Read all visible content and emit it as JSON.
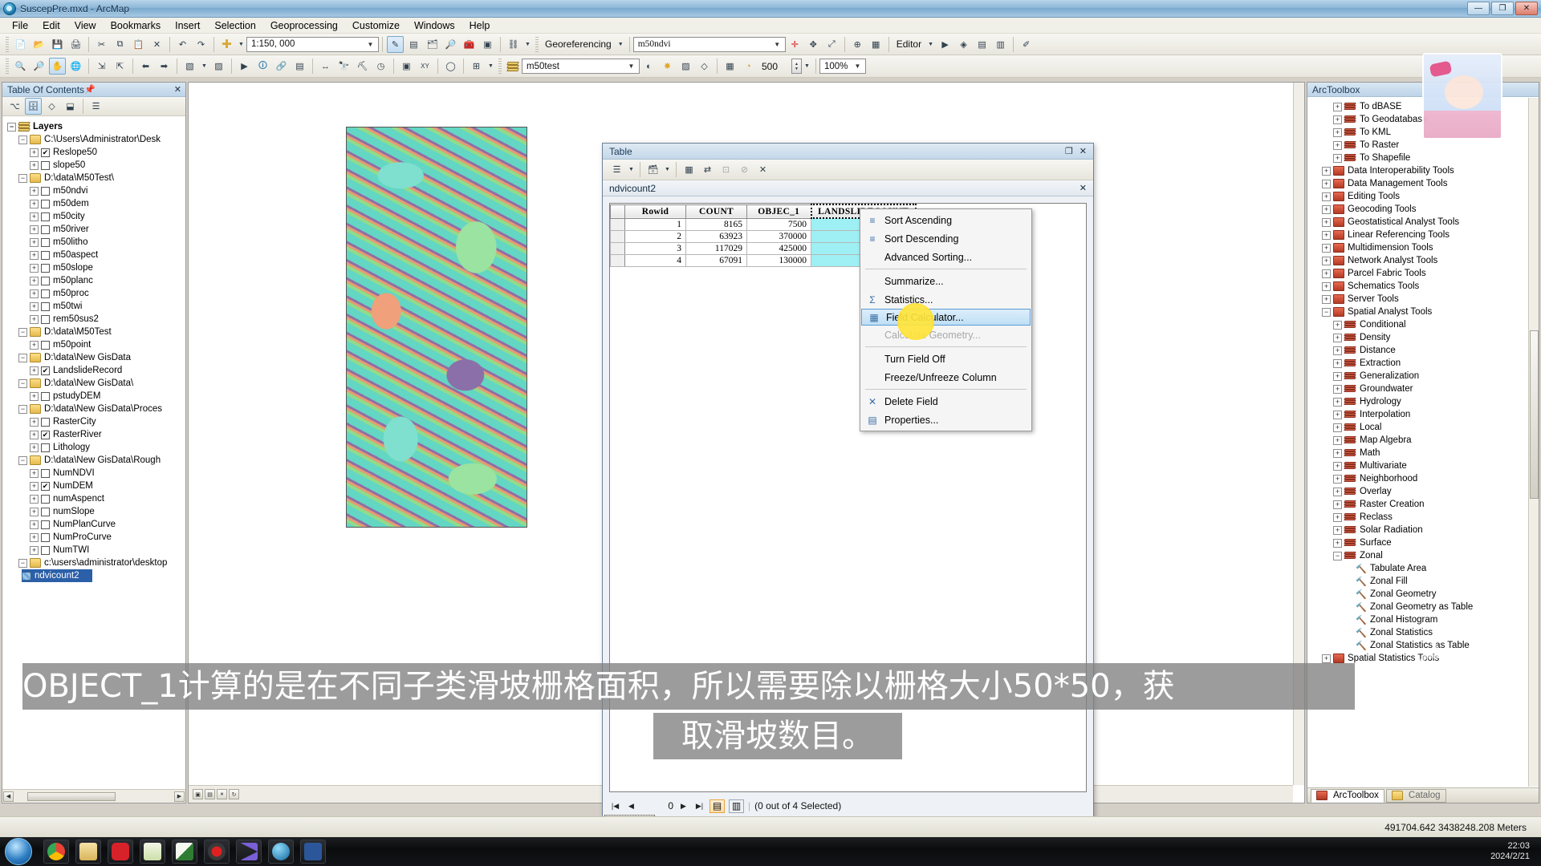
{
  "window": {
    "title": "SuscepPre.mxd - ArcMap",
    "icon": "arcmap-globe-icon",
    "minimize": "—",
    "restore": "❐",
    "close": "✕"
  },
  "menubar": [
    "File",
    "Edit",
    "View",
    "Bookmarks",
    "Insert",
    "Selection",
    "Geoprocessing",
    "Customize",
    "Windows",
    "Help"
  ],
  "toolbar": {
    "scale_value": "1:150, 000",
    "georeferencing_label": "Georeferencing",
    "georef_layer": "m50ndvi",
    "sa_layer": "m50test",
    "cellsize_value": "500",
    "editor_label": "Editor",
    "zoom_percent": "100%",
    "search_value": ""
  },
  "toc": {
    "header": "Table Of Contents",
    "pin_icon": "pin-icon",
    "close_icon": "close-icon",
    "root": "Layers",
    "items": [
      {
        "type": "folder",
        "label": "C:\\Users\\Administrator\\Desk",
        "indent": 1
      },
      {
        "type": "layer",
        "label": "Reslope50",
        "checked": true,
        "indent": 2
      },
      {
        "type": "layer",
        "label": "slope50",
        "checked": false,
        "indent": 2
      },
      {
        "type": "folder",
        "label": "D:\\data\\M50Test\\",
        "indent": 1
      },
      {
        "type": "layer",
        "label": "m50ndvi",
        "checked": false,
        "indent": 2
      },
      {
        "type": "layer",
        "label": "m50dem",
        "checked": false,
        "indent": 2
      },
      {
        "type": "layer",
        "label": "m50city",
        "checked": false,
        "indent": 2
      },
      {
        "type": "layer",
        "label": "m50river",
        "checked": false,
        "indent": 2
      },
      {
        "type": "layer",
        "label": "m50litho",
        "checked": false,
        "indent": 2
      },
      {
        "type": "layer",
        "label": "m50aspect",
        "checked": false,
        "indent": 2
      },
      {
        "type": "layer",
        "label": "m50slope",
        "checked": false,
        "indent": 2
      },
      {
        "type": "layer",
        "label": "m50planc",
        "checked": false,
        "indent": 2
      },
      {
        "type": "layer",
        "label": "m50proc",
        "checked": false,
        "indent": 2
      },
      {
        "type": "layer",
        "label": "m50twi",
        "checked": false,
        "indent": 2
      },
      {
        "type": "layer",
        "label": "rem50sus2",
        "checked": false,
        "indent": 2
      },
      {
        "type": "folder",
        "label": "D:\\data\\M50Test",
        "indent": 1
      },
      {
        "type": "layer",
        "label": "m50point",
        "checked": false,
        "indent": 2
      },
      {
        "type": "folder",
        "label": "D:\\data\\New GisData",
        "indent": 1
      },
      {
        "type": "layer",
        "label": "LandslideRecord",
        "checked": true,
        "indent": 2
      },
      {
        "type": "folder",
        "label": "D:\\data\\New GisData\\",
        "indent": 1
      },
      {
        "type": "layer",
        "label": "pstudyDEM",
        "checked": false,
        "indent": 2
      },
      {
        "type": "folder",
        "label": "D:\\data\\New GisData\\Proces",
        "indent": 1
      },
      {
        "type": "layer",
        "label": "RasterCity",
        "checked": false,
        "indent": 2
      },
      {
        "type": "layer",
        "label": "RasterRiver",
        "checked": true,
        "indent": 2
      },
      {
        "type": "layer",
        "label": "Lithology",
        "checked": false,
        "indent": 2
      },
      {
        "type": "folder",
        "label": "D:\\data\\New GisData\\Rough",
        "indent": 1
      },
      {
        "type": "layer",
        "label": "NumNDVI",
        "checked": false,
        "indent": 2
      },
      {
        "type": "layer",
        "label": "NumDEM",
        "checked": true,
        "indent": 2
      },
      {
        "type": "layer",
        "label": "numAspenct",
        "checked": false,
        "indent": 2
      },
      {
        "type": "layer",
        "label": "numSlope",
        "checked": false,
        "indent": 2
      },
      {
        "type": "layer",
        "label": "NumPlanCurve",
        "checked": false,
        "indent": 2
      },
      {
        "type": "layer",
        "label": "NumProCurve",
        "checked": false,
        "indent": 2
      },
      {
        "type": "layer",
        "label": "NumTWI",
        "checked": false,
        "indent": 2
      },
      {
        "type": "folder",
        "label": "c:\\users\\administrator\\desktop",
        "indent": 1
      },
      {
        "type": "selected",
        "label": "ndvicount2",
        "indent": 2
      }
    ]
  },
  "table_window": {
    "title": "Table",
    "restore_icon": "restore-icon",
    "close_icon": "close-icon",
    "tab_label": "ndvicount2",
    "tab_close_icon": "close-icon",
    "columns": [
      "Rowid",
      "COUNT",
      "OBJEC_1",
      "LANDSLIDECOUNT"
    ],
    "selected_column": "LANDSLIDECOUNT",
    "rows": [
      {
        "Rowid": "1",
        "COUNT": "8165",
        "OBJEC_1": "7500",
        "LANDSLIDECOUNT": ""
      },
      {
        "Rowid": "2",
        "COUNT": "63923",
        "OBJEC_1": "370000",
        "LANDSLIDECOUNT": ""
      },
      {
        "Rowid": "3",
        "COUNT": "117029",
        "OBJEC_1": "425000",
        "LANDSLIDECOUNT": ""
      },
      {
        "Rowid": "4",
        "COUNT": "67091",
        "OBJEC_1": "130000",
        "LANDSLIDECOUNT": ""
      }
    ],
    "nav": {
      "first_icon": "first-record-icon",
      "prev_icon": "previous-record-icon",
      "record_number": "0",
      "next_icon": "next-record-icon",
      "last_icon": "last-record-icon",
      "table_view_icon": "table-view-icon",
      "form_view_icon": "form-view-icon",
      "selection_status": "(0 out of 4 Selected)"
    },
    "status_label": "ndvicount2"
  },
  "context_menu": {
    "highlighted": "Field Calculator...",
    "items": [
      {
        "label": "Sort Ascending",
        "icon": "sort-ascending-icon",
        "enabled": true,
        "sep_after": false
      },
      {
        "label": "Sort Descending",
        "icon": "sort-descending-icon",
        "enabled": true,
        "sep_after": false
      },
      {
        "label": "Advanced Sorting...",
        "icon": "",
        "enabled": true,
        "sep_after": true
      },
      {
        "label": "Summarize...",
        "icon": "",
        "enabled": true,
        "sep_after": false
      },
      {
        "label": "Statistics...",
        "icon": "sigma-icon",
        "enabled": true,
        "sep_after": false
      },
      {
        "label": "Field Calculator...",
        "icon": "calculator-icon",
        "enabled": true,
        "sep_after": false
      },
      {
        "label": "Calculate Geometry...",
        "icon": "",
        "enabled": false,
        "sep_after": true
      },
      {
        "label": "Turn Field Off",
        "icon": "",
        "enabled": true,
        "sep_after": false
      },
      {
        "label": "Freeze/Unfreeze Column",
        "icon": "",
        "enabled": true,
        "sep_after": true
      },
      {
        "label": "Delete Field",
        "icon": "delete-x-icon",
        "enabled": true,
        "sep_after": false
      },
      {
        "label": "Properties...",
        "icon": "properties-icon",
        "enabled": true,
        "sep_after": false
      }
    ]
  },
  "arctoolbox": {
    "header": "ArcToolbox",
    "items": [
      {
        "label": "To dBASE",
        "kind": "toolset",
        "indent": 2,
        "expand": "+"
      },
      {
        "label": "To Geodatabase",
        "kind": "toolset",
        "indent": 2,
        "expand": "+"
      },
      {
        "label": "To KML",
        "kind": "toolset",
        "indent": 2,
        "expand": "+"
      },
      {
        "label": "To Raster",
        "kind": "toolset",
        "indent": 2,
        "expand": "+"
      },
      {
        "label": "To Shapefile",
        "kind": "toolset",
        "indent": 2,
        "expand": "+"
      },
      {
        "label": "Data Interoperability Tools",
        "kind": "toolbox",
        "indent": 1,
        "expand": "+"
      },
      {
        "label": "Data Management Tools",
        "kind": "toolbox",
        "indent": 1,
        "expand": "+"
      },
      {
        "label": "Editing Tools",
        "kind": "toolbox",
        "indent": 1,
        "expand": "+"
      },
      {
        "label": "Geocoding Tools",
        "kind": "toolbox",
        "indent": 1,
        "expand": "+"
      },
      {
        "label": "Geostatistical Analyst Tools",
        "kind": "toolbox",
        "indent": 1,
        "expand": "+"
      },
      {
        "label": "Linear Referencing Tools",
        "kind": "toolbox",
        "indent": 1,
        "expand": "+"
      },
      {
        "label": "Multidimension Tools",
        "kind": "toolbox",
        "indent": 1,
        "expand": "+"
      },
      {
        "label": "Network Analyst Tools",
        "kind": "toolbox",
        "indent": 1,
        "expand": "+"
      },
      {
        "label": "Parcel Fabric Tools",
        "kind": "toolbox",
        "indent": 1,
        "expand": "+"
      },
      {
        "label": "Schematics Tools",
        "kind": "toolbox",
        "indent": 1,
        "expand": "+"
      },
      {
        "label": "Server Tools",
        "kind": "toolbox",
        "indent": 1,
        "expand": "+"
      },
      {
        "label": "Spatial Analyst Tools",
        "kind": "toolbox",
        "indent": 1,
        "expand": "-"
      },
      {
        "label": "Conditional",
        "kind": "toolset",
        "indent": 2,
        "expand": "+"
      },
      {
        "label": "Density",
        "kind": "toolset",
        "indent": 2,
        "expand": "+"
      },
      {
        "label": "Distance",
        "kind": "toolset",
        "indent": 2,
        "expand": "+"
      },
      {
        "label": "Extraction",
        "kind": "toolset",
        "indent": 2,
        "expand": "+"
      },
      {
        "label": "Generalization",
        "kind": "toolset",
        "indent": 2,
        "expand": "+"
      },
      {
        "label": "Groundwater",
        "kind": "toolset",
        "indent": 2,
        "expand": "+"
      },
      {
        "label": "Hydrology",
        "kind": "toolset",
        "indent": 2,
        "expand": "+"
      },
      {
        "label": "Interpolation",
        "kind": "toolset",
        "indent": 2,
        "expand": "+"
      },
      {
        "label": "Local",
        "kind": "toolset",
        "indent": 2,
        "expand": "+"
      },
      {
        "label": "Map Algebra",
        "kind": "toolset",
        "indent": 2,
        "expand": "+"
      },
      {
        "label": "Math",
        "kind": "toolset",
        "indent": 2,
        "expand": "+"
      },
      {
        "label": "Multivariate",
        "kind": "toolset",
        "indent": 2,
        "expand": "+"
      },
      {
        "label": "Neighborhood",
        "kind": "toolset",
        "indent": 2,
        "expand": "+"
      },
      {
        "label": "Overlay",
        "kind": "toolset",
        "indent": 2,
        "expand": "+"
      },
      {
        "label": "Raster Creation",
        "kind": "toolset",
        "indent": 2,
        "expand": "+"
      },
      {
        "label": "Reclass",
        "kind": "toolset",
        "indent": 2,
        "expand": "+"
      },
      {
        "label": "Solar Radiation",
        "kind": "toolset",
        "indent": 2,
        "expand": "+"
      },
      {
        "label": "Surface",
        "kind": "toolset",
        "indent": 2,
        "expand": "+"
      },
      {
        "label": "Zonal",
        "kind": "toolset",
        "indent": 2,
        "expand": "-"
      },
      {
        "label": "Tabulate Area",
        "kind": "tool",
        "indent": 3,
        "expand": ""
      },
      {
        "label": "Zonal Fill",
        "kind": "tool",
        "indent": 3,
        "expand": ""
      },
      {
        "label": "Zonal Geometry",
        "kind": "tool",
        "indent": 3,
        "expand": ""
      },
      {
        "label": "Zonal Geometry as Table",
        "kind": "tool",
        "indent": 3,
        "expand": ""
      },
      {
        "label": "Zonal Histogram",
        "kind": "tool",
        "indent": 3,
        "expand": ""
      },
      {
        "label": "Zonal Statistics",
        "kind": "tool",
        "indent": 3,
        "expand": ""
      },
      {
        "label": "Zonal Statistics as Table",
        "kind": "tool",
        "indent": 3,
        "expand": ""
      },
      {
        "label": "Spatial Statistics Tools",
        "kind": "toolbox",
        "indent": 1,
        "expand": "+"
      }
    ],
    "tabs": [
      {
        "label": "ArcToolbox",
        "active": true
      },
      {
        "label": "Catalog",
        "active": false
      }
    ]
  },
  "statusbar": {
    "coordinates": "491704.642  3438248.208 Meters"
  },
  "subtitles": {
    "line1": "OBJECT_1计算的是在不同子类滑坡栅格面积，所以需要除以栅格大小50*50，获",
    "line2": "取滑坡数目。"
  },
  "taskbar": {
    "start_icon": "windows-start-icon",
    "items": [
      {
        "name": "chrome-icon",
        "color": "#d94b3a"
      },
      {
        "name": "file-explorer-icon",
        "color": "#e8c46a"
      },
      {
        "name": "netease-music-icon",
        "color": "#d8222a"
      },
      {
        "name": "notepad-plus-icon",
        "color": "#e9f0d6"
      },
      {
        "name": "excel-icon",
        "color": "#cfe3c2"
      },
      {
        "name": "recorder-icon",
        "color": "#4a4a4a"
      },
      {
        "name": "media-player-icon",
        "color": "#7a5fd6"
      },
      {
        "name": "arcmap-icon",
        "color": "#4aa3d8"
      },
      {
        "name": "word-icon",
        "color": "#2b579a"
      }
    ],
    "clock_time": "22:03",
    "clock_date": "2024/2/21"
  }
}
